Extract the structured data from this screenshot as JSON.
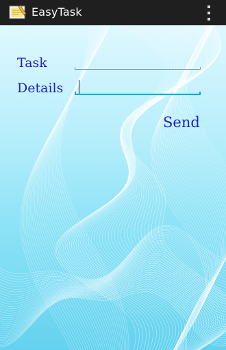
{
  "app": {
    "title": "EasyTask"
  },
  "form": {
    "task_label": "Task",
    "details_label": "Details",
    "task_value": "",
    "details_value": "",
    "send_label": "Send"
  },
  "colors": {
    "action_bar": "#1f1f1f",
    "label_text": "#1f25b8",
    "field_focus_underline": "#2aa4c8",
    "background_light": "#dff8ff",
    "background_dark": "#64d2ef"
  },
  "icons": {
    "app": "notepad-icon",
    "menu": "overflow-menu-icon"
  }
}
